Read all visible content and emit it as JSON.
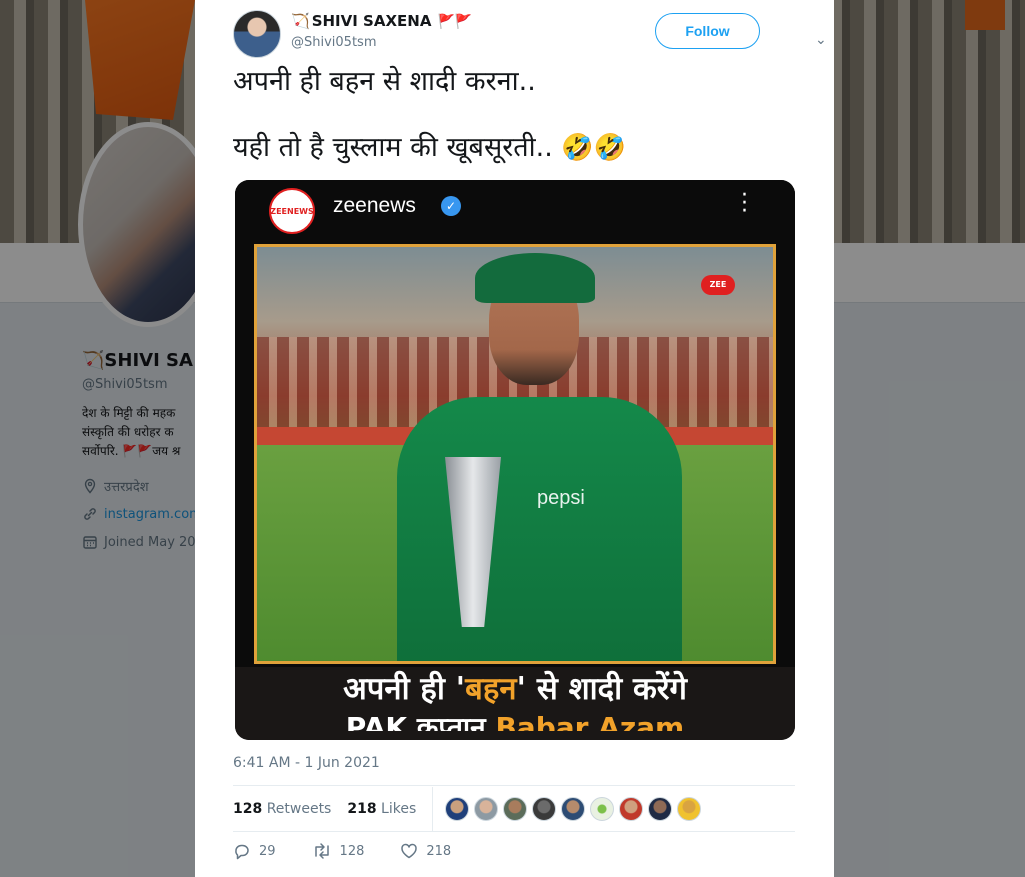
{
  "background_profile": {
    "name": "🏹SHIVI SA",
    "handle": "@Shivi05tsm",
    "bio": "देश के मिट्टी की महक संस्कृति की धरोहर क सर्वोपरि. 🚩🚩जय श्र",
    "location": "उत्तरप्रदेश",
    "link": "instagram.com",
    "joined": "Joined May 20"
  },
  "tweet": {
    "author": {
      "name_prefix": "🏹",
      "name": "SHIVI SAXENA",
      "name_suffix": "🚩🚩",
      "handle": "@Shivi05tsm"
    },
    "follow_label": "Follow",
    "text_line1": "अपनी ही बहन से शादी करना..",
    "text_line2": "यही तो है चुस्लाम की खूबसूरती..",
    "emojis": "🤣🤣",
    "media": {
      "account": "zeenews",
      "logo_text": "ZEENEWS",
      "bug_text": "ZEE",
      "shirt_text": "pepsi",
      "caption_line1_pre": "अपनी ही '",
      "caption_line1_hl": "बहन",
      "caption_line1_post": "' से शादी करेंगे",
      "caption_line2_pre": "PAK कप्तान ",
      "caption_line2_hl": "Babar Azam"
    },
    "timestamp": "6:41 AM - 1 Jun 2021",
    "retweets_count": "128",
    "retweets_label": "Retweets",
    "likes_count": "218",
    "likes_label": "Likes",
    "actions": {
      "reply_count": "29",
      "retweet_count": "128",
      "like_count": "218"
    }
  },
  "colors": {
    "accent": "#1da1f2",
    "highlight": "#f2a22a",
    "secondary_text": "#657786"
  }
}
